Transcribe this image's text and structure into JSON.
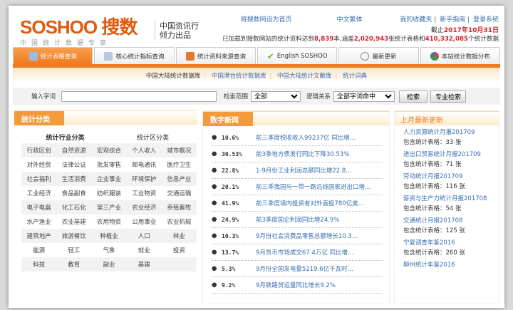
{
  "logo": {
    "text": "SOSHOO",
    "cn": "搜数",
    "sub": "中国统计数据专家",
    "slogan1": "中国资讯行",
    "slogan2": "倾力出品"
  },
  "toplinks": [
    "将搜数网设为首页",
    "中文繁体",
    "我的收藏夹",
    "新手指南",
    "登录系统"
  ],
  "date": {
    "prefix": "截止",
    "value": "2017年10月31日"
  },
  "stats": {
    "p1": "已加载到搜数网站的统计资料达到",
    "books": "8,839",
    "p2": "本,涵盖",
    "tables": "2,020,943",
    "p3": "张统计表格和",
    "data": "410,332,085",
    "p4": "个统计数据"
  },
  "nav": [
    {
      "label": "统计表格查询",
      "icon": "table-icon",
      "color": "#9bbbe0"
    },
    {
      "label": "核心统计指标查询",
      "icon": "document-icon",
      "color": "#b6c8e0"
    },
    {
      "label": "统计资料来源查询",
      "icon": "bar-chart-icon",
      "color": "#e07a2e"
    },
    {
      "label": "English SOSHOO",
      "icon": "check-icon",
      "color": "#6cb83a"
    },
    {
      "label": "最新更新",
      "icon": "clock-icon",
      "color": "#888"
    },
    {
      "label": "本站统计数据分布",
      "icon": "pie-chart-icon",
      "color": "#3a9a4a"
    }
  ],
  "sublinks": [
    "中国大陆统计数据库",
    "中国港台统计数据库",
    "中国大陆统计文献库",
    "统计词典"
  ],
  "search": {
    "label": "输入字词",
    "value": "",
    "scope_label": "检索范围",
    "scope": "全部",
    "logic_label": "逻辑关系",
    "logic": "全部字词命中",
    "search_btn": "检索",
    "adv_btn": "专业检索"
  },
  "categories": {
    "title": "统计分类",
    "tab1": "统计行业分类",
    "tab2": "统计区分类",
    "rows": [
      [
        "行政区划",
        "自然资源",
        "宏观综合",
        "个人收入",
        "城市概况"
      ],
      [
        "对外经贸",
        "法律公证",
        "批发零售",
        "邮电通讯",
        "医疗卫生"
      ],
      [
        "社会福利",
        "生活消费",
        "企业事业",
        "环境保护",
        "信息产业"
      ],
      [
        "工业经济",
        "食品副食",
        "纺织服装",
        "工业物资",
        "交通运输"
      ],
      [
        "电子电器",
        "化工石化",
        "第三产业",
        "农业经济",
        "养殖畜牧"
      ],
      [
        "水产渔业",
        "农业基建",
        "农用物资",
        "公用事业",
        "农业机械"
      ],
      [
        "建筑地产",
        "旅游餐饮",
        "种植业",
        "人口",
        "林业"
      ],
      [
        "能源",
        "轻工",
        "气象",
        "就业",
        "投资"
      ],
      [
        "科技",
        "教育",
        "副业",
        "基建",
        ""
      ]
    ]
  },
  "news": {
    "title": "数字新闻",
    "items": [
      {
        "v": "10.6%",
        "t": "前三季度税收收入99237亿 同比增…"
      },
      {
        "v": "30.53%",
        "t": "前3季地方债发行同比下降30.53%"
      },
      {
        "v": "22.8%",
        "t": "1-9月份工业利润总额同比增22.8…"
      },
      {
        "v": "20.1%",
        "t": "前三季我国与一带一路沿线国家进出口增…"
      },
      {
        "v": "41.9%",
        "t": "前三季度境内投资者对外直投780亿美…"
      },
      {
        "v": "24.9%",
        "t": "前3季度国企利润同比增24.9%"
      },
      {
        "v": "10.3%",
        "t": "9月份社会消费品零售总额增长10.3…"
      },
      {
        "v": "13.7%",
        "t": "9月货币市场成交67.4万亿 同比增…"
      },
      {
        "v": "5.3%",
        "t": "9月份全国发电量5219.6亿千瓦时…"
      },
      {
        "v": "9.2%",
        "t": "9月铁路货运量同比增长9.2%"
      }
    ]
  },
  "updates": {
    "title": "上月最新更新",
    "items": [
      {
        "n": "人力资源统计月报201709",
        "c": "包含统计表格：33 张"
      },
      {
        "n": "进出口贸易统计月报201709",
        "c": "包含统计表格：71 张"
      },
      {
        "n": "劳动统计月报201709",
        "c": "包含统计表格：116 张"
      },
      {
        "n": "薪资与生产力统计月报201708",
        "c": "包含统计表格：54 张"
      },
      {
        "n": "交通统计月报201708",
        "c": "包含统计表格：125 张"
      },
      {
        "n": "宁夏调查年鉴2016",
        "c": "包含统计表格：260 张"
      },
      {
        "n": "柳州统计年鉴2016",
        "c": ""
      }
    ]
  }
}
